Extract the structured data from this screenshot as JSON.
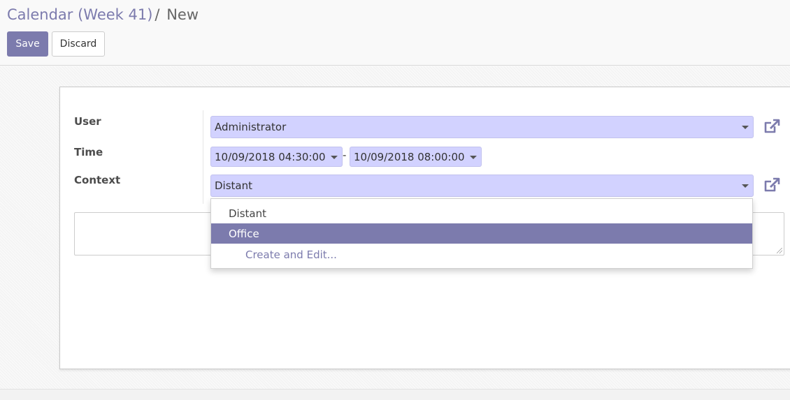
{
  "breadcrumb": {
    "parent": "Calendar (Week 41)",
    "separator": "/",
    "current": "New"
  },
  "buttons": {
    "save": "Save",
    "discard": "Discard"
  },
  "form": {
    "user": {
      "label": "User",
      "value": "Administrator"
    },
    "time": {
      "label": "Time",
      "start": "10/09/2018 04:30:00",
      "separator": "-",
      "end": "10/09/2018 08:00:00"
    },
    "context": {
      "label": "Context",
      "value": "Distant",
      "options": [
        {
          "label": "Distant",
          "highlighted": false
        },
        {
          "label": "Office",
          "highlighted": true
        },
        {
          "label": "Create and Edit...",
          "highlighted": false
        }
      ]
    },
    "notes": {
      "value": ""
    }
  },
  "colors": {
    "accent": "#7c7bad",
    "field_bg": "#d2d2ff"
  },
  "icons": {
    "external_link": "external-link-icon",
    "caret": "caret-down-icon"
  }
}
